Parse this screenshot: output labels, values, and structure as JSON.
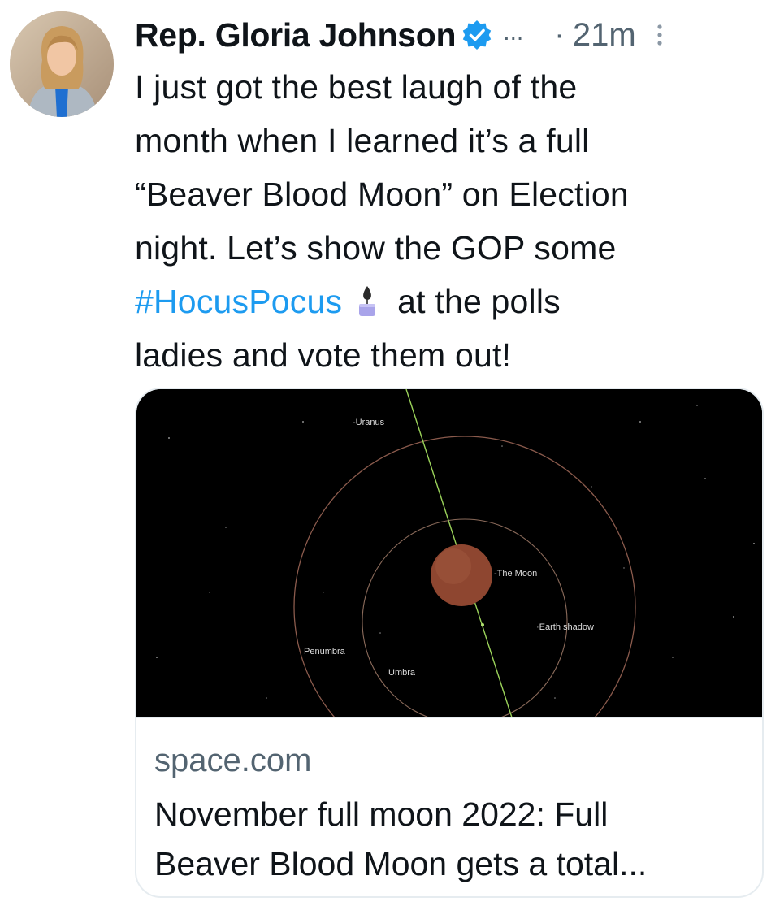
{
  "author": {
    "display_name": "Rep. Gloria Johnson",
    "verified_icon": "verified-badge-icon",
    "ellipsis": "...",
    "separator": "·",
    "timestamp": "21m"
  },
  "tweet": {
    "lines": [
      "I just got the best laugh of the",
      "month when I learned it’s a full",
      "“Beaver Blood Moon” on Election",
      "night. Let’s show the GOP some"
    ],
    "hashtag": "#HocusPocus",
    "after_hashtag": "at the polls",
    "last_line": "ladies and vote them out!",
    "emoji": "candle-icon"
  },
  "link_card": {
    "image_labels": {
      "uranus": "Uranus",
      "moon": "The Moon",
      "earth_shadow": "Earth shadow",
      "penumbra": "Penumbra",
      "umbra": "Umbra"
    },
    "domain": "space.com",
    "title_lines": [
      "November full moon 2022: Full",
      "Beaver Blood Moon gets a total..."
    ]
  },
  "colors": {
    "hashtag": "#1d9bf0",
    "verified": "#1d9bf0",
    "muted_text": "#536471",
    "moon": "#8e4630"
  }
}
